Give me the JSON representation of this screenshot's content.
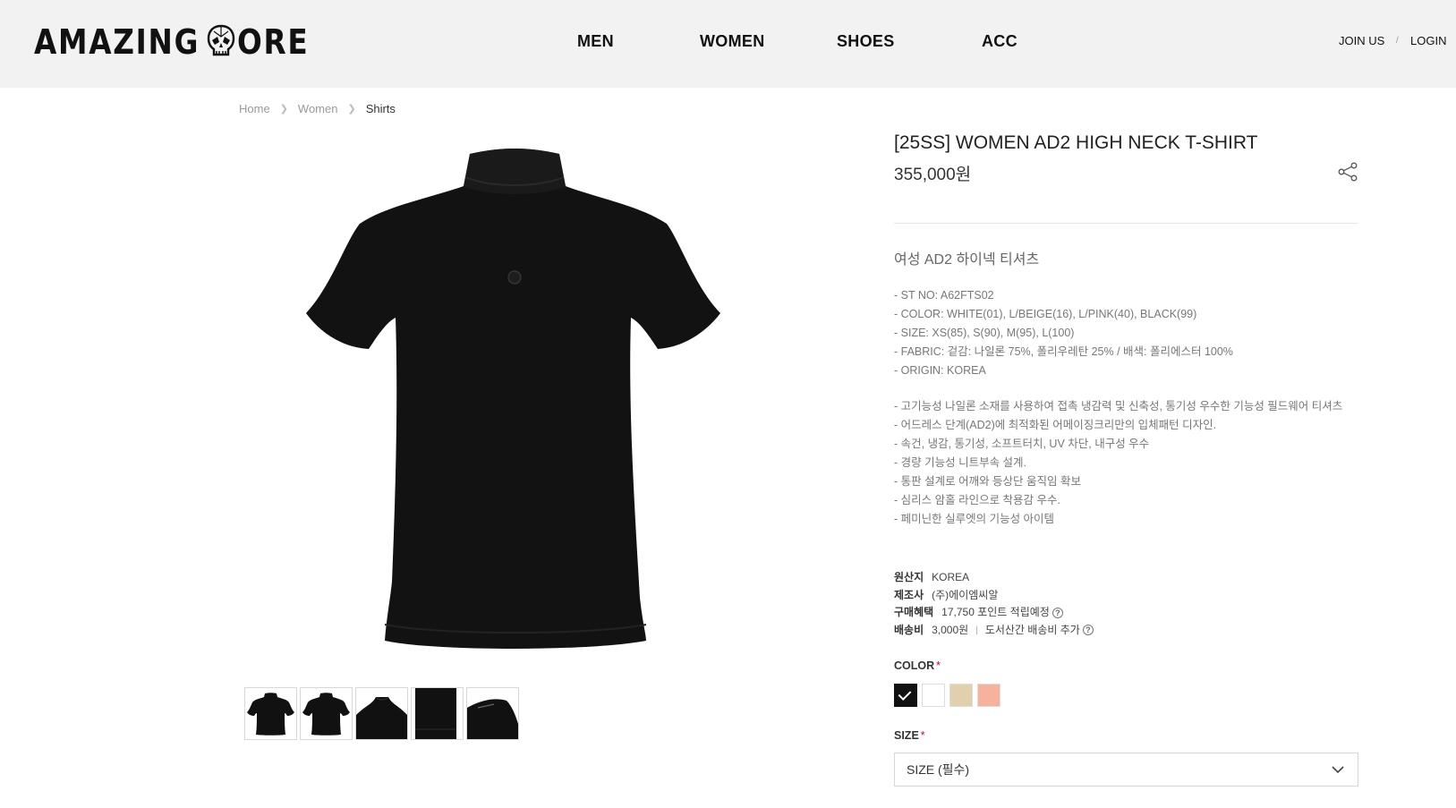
{
  "header": {
    "logo_left": "AMAZING",
    "logo_right": "ORE",
    "nav": [
      "MEN",
      "WOMEN",
      "SHOES",
      "ACC"
    ],
    "join_label": "JOIN US",
    "separator": "/",
    "login_label": "LOGIN"
  },
  "breadcrumb": {
    "items": [
      "Home",
      "Women",
      "Shirts"
    ]
  },
  "product": {
    "title": "[25SS] WOMEN AD2 HIGH NECK T-SHIRT",
    "price": "355,000원",
    "subtitle": "여성 AD2 하이넥 티셔츠",
    "specs": [
      "- ST NO: A62FTS02",
      "- COLOR: WHITE(01), L/BEIGE(16), L/PINK(40), BLACK(99)",
      "- SIZE: XS(85), S(90), M(95), L(100)",
      "- FABRIC: 겉감: 나일론 75%, 폴리우레탄 25% / 배색: 폴리에스터 100%",
      "- ORIGIN: KOREA"
    ],
    "description": [
      "- 고기능성 나일론 소재를 사용하여 접촉 냉감력 및 신축성, 통기성 우수한 기능성 필드웨어 티셔츠",
      "- 어드레스 단계(AD2)에 최적화된 어메이징크리만의 입체패턴 디자인.",
      "- 속건, 냉감, 통기성, 소프트터치, UV 차단, 내구성 우수",
      "- 경량 기능성 니트부속 설계.",
      "- 통판 설계로 어깨와 등상단 움직임 확보",
      "- 심리스 암홀 라인으로 착용감 우수.",
      "- 페미닌한 실루엣의 기능성 아이템"
    ],
    "meta": {
      "origin_label": "원산지",
      "origin_value": "KOREA",
      "maker_label": "제조사",
      "maker_value": "(주)에이엠씨알",
      "benefit_label": "구매혜택",
      "benefit_value": "17,750 포인트 적립예정",
      "shipping_label": "배송비",
      "shipping_value": "3,000원",
      "shipping_extra": "도서산간 배송비 추가",
      "help_mark": "?",
      "separator": "|"
    },
    "color_label": "COLOR",
    "required_mark": "*",
    "colors": [
      "#111111",
      "#ffffff",
      "#e2cfae",
      "#f6b29c"
    ],
    "selected_color_index": 0,
    "size_label": "SIZE",
    "size_placeholder": "SIZE (필수)"
  },
  "icons": {
    "share": "share-icon",
    "chevron": "chevron-down-icon",
    "logo_mark": "skull-icon"
  }
}
